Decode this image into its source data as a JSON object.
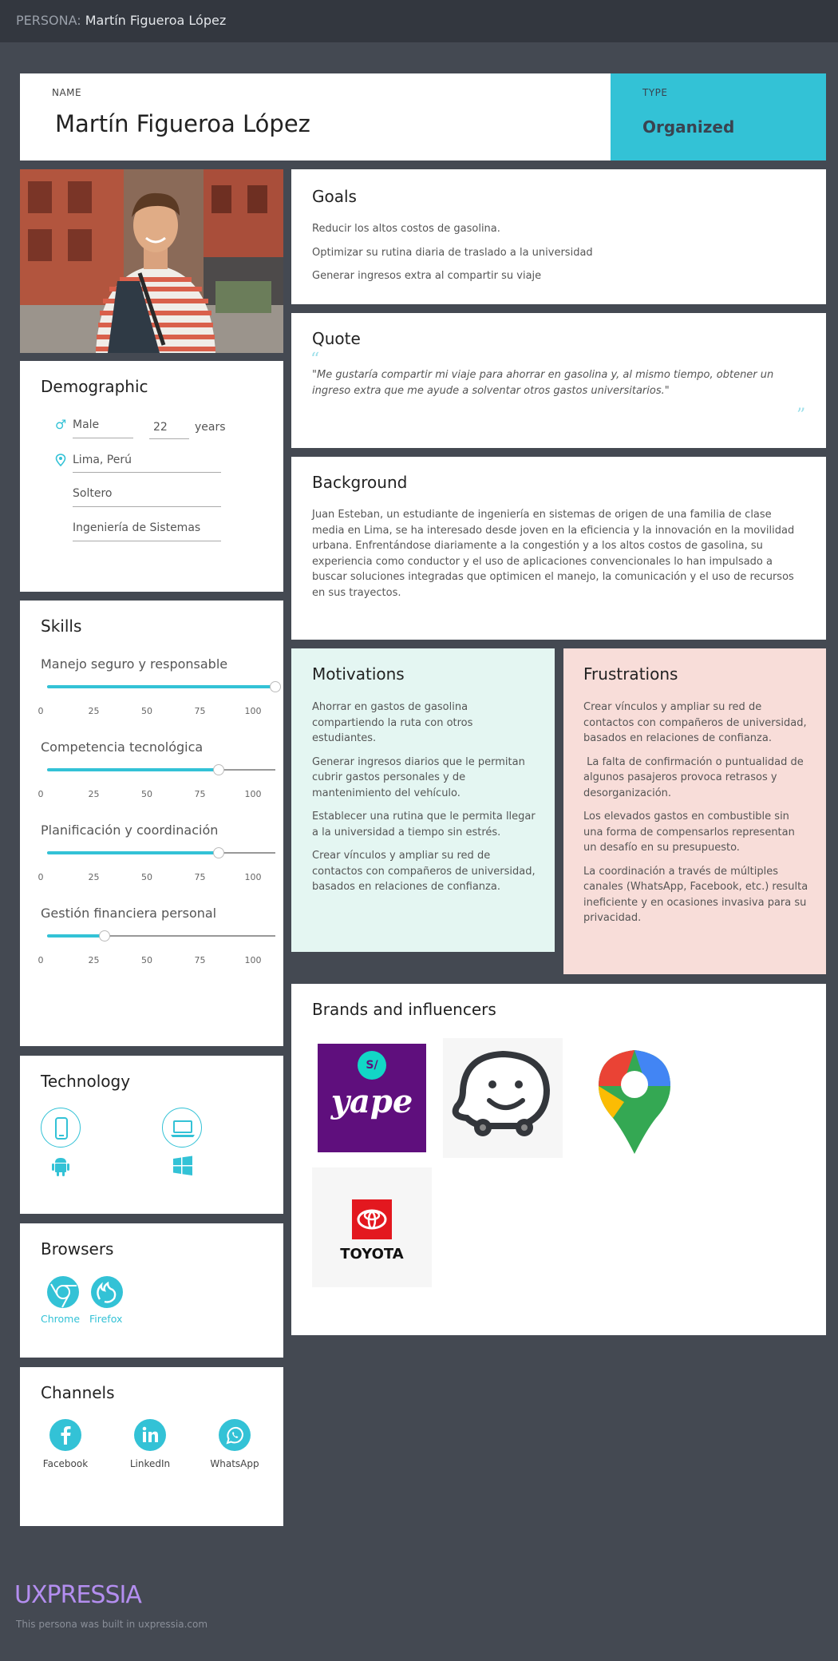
{
  "header": {
    "prefix": "PERSONA:",
    "name": "Martín Figueroa López"
  },
  "persona": {
    "name_label": "NAME",
    "name": "Martín Figueroa López",
    "type_label": "TYPE",
    "type": "Organized"
  },
  "goals": {
    "title": "Goals",
    "items": [
      "Reducir los altos costos de gasolina.",
      "Optimizar su rutina diaria de traslado a la universidad",
      "Generar ingresos extra al compartir su viaje"
    ]
  },
  "quote": {
    "title": "Quote",
    "text": "\"Me gustaría compartir mi viaje para ahorrar en gasolina y, al mismo tiempo, obtener un ingreso extra que me ayude a solventar otros gastos universitarios.\""
  },
  "background": {
    "title": "Background",
    "text": "Juan Esteban, un estudiante de ingeniería en sistemas de origen de una familia de clase media en Lima, se ha interesado desde joven en la eficiencia y la innovación en la movilidad urbana. Enfrentándose diariamente a la congestión y a los altos costos de gasolina, su experiencia como conductor y el uso de aplicaciones convencionales lo han impulsado a buscar soluciones integradas que optimicen el manejo, la comunicación y el uso de recursos en sus trayectos."
  },
  "demographic": {
    "title": "Demographic",
    "gender": "Male",
    "age": "22",
    "age_unit": "years",
    "location": "Lima, Perú",
    "status": "Soltero",
    "career": "Ingeniería de Sistemas"
  },
  "skills": {
    "title": "Skills",
    "ticks": [
      "0",
      "25",
      "50",
      "75",
      "100"
    ],
    "items": [
      {
        "label": "Manejo seguro y responsable",
        "value": 100
      },
      {
        "label": "Competencia tecnológica",
        "value": 75
      },
      {
        "label": "Planificación y coordinación",
        "value": 75
      },
      {
        "label": "Gestión financiera personal",
        "value": 25
      }
    ]
  },
  "technology": {
    "title": "Technology",
    "icons": [
      "mobile-icon",
      "laptop-icon",
      "android-icon",
      "windows-icon"
    ]
  },
  "browsers": {
    "title": "Browsers",
    "items": [
      "Chrome",
      "Firefox"
    ]
  },
  "channels": {
    "title": "Channels",
    "items": [
      "Facebook",
      "LinkedIn",
      "WhatsApp"
    ]
  },
  "motivations": {
    "title": "Motivations",
    "items": [
      "Ahorrar en gastos de gasolina compartiendo la ruta con otros estudiantes.",
      "Generar ingresos diarios que le permitan cubrir gastos personales y de mantenimiento del vehículo.",
      "Establecer una rutina que le permita llegar a la universidad a tiempo sin estrés.",
      "Crear vínculos y ampliar su red de contactos con compañeros de universidad, basados en relaciones de confianza."
    ]
  },
  "frustrations": {
    "title": "Frustrations",
    "items": [
      "Crear vínculos y ampliar su red de contactos con compañeros de universidad, basados en relaciones de confianza.",
      " La falta de confirmación o puntualidad de algunos pasajeros provoca retrasos y desorganización.",
      "Los elevados gastos en combustible sin una forma de compensarlos representan un desafío en su presupuesto.",
      "La coordinación a través de múltiples canales (WhatsApp, Facebook, etc.) resulta ineficiente y en ocasiones invasiva para su privacidad."
    ]
  },
  "brands": {
    "title": "Brands and influencers",
    "yape_badge": "S/",
    "yape_word": "yape",
    "toyota_word": "TOYOTA"
  },
  "footer": {
    "logo": "UXPRESSIA",
    "note": "This persona was built in uxpressia.com"
  },
  "colors": {
    "accent": "#33c2d6",
    "bg": "#444952",
    "motivations_bg": "#e4f6f2",
    "frustrations_bg": "#f8ddd9"
  }
}
